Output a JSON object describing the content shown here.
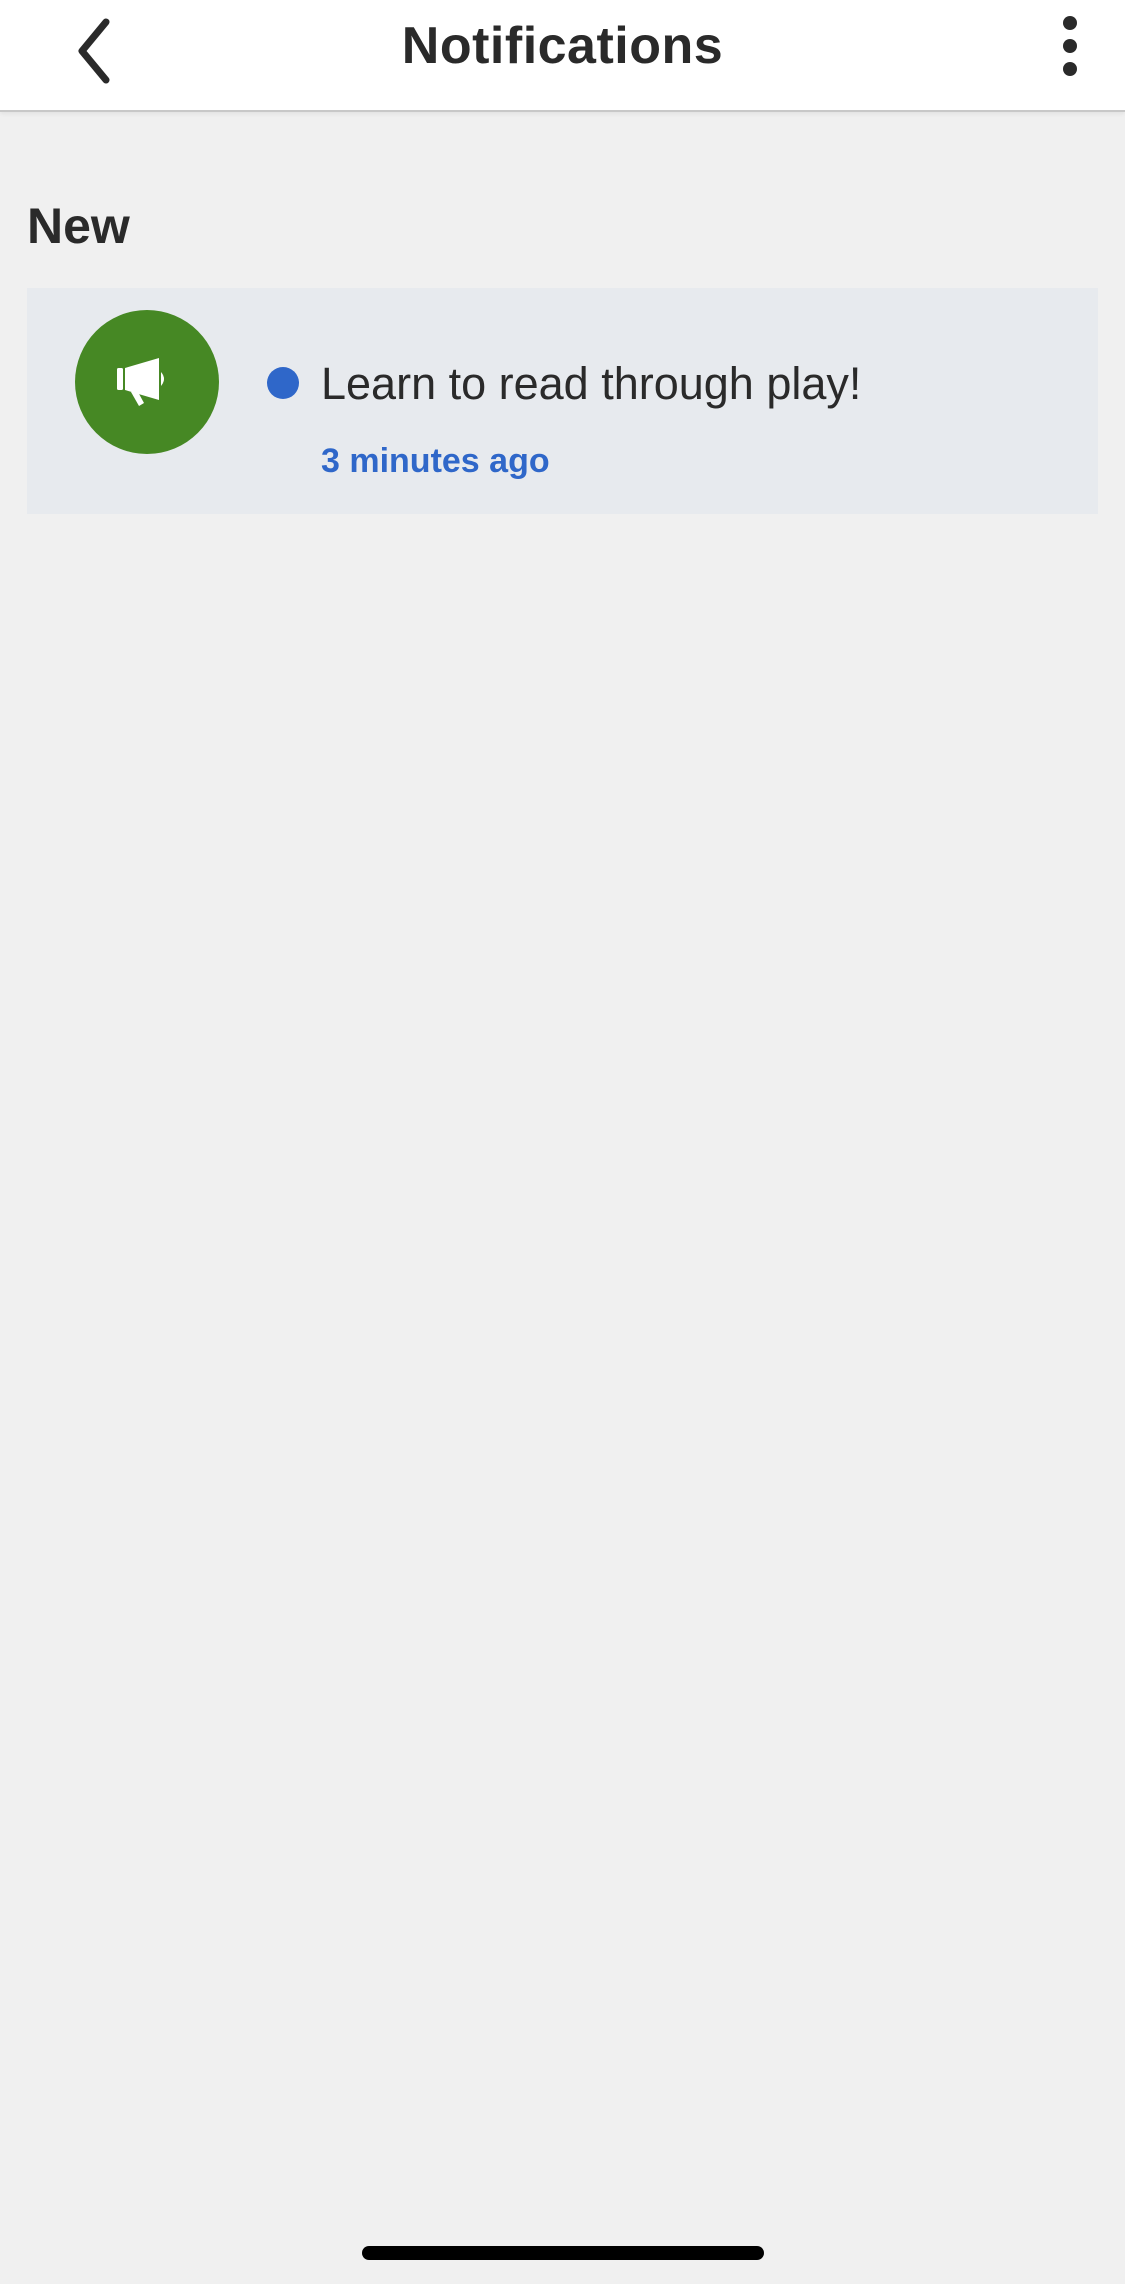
{
  "header": {
    "title": "Notifications",
    "back_icon": "chevron-left-icon",
    "more_icon": "more-vertical-icon"
  },
  "section": {
    "title": "New"
  },
  "notifications": [
    {
      "icon": "megaphone-icon",
      "icon_bg_color": "#468824",
      "unread": true,
      "title": "Learn to read through play!",
      "time": "3 minutes ago"
    }
  ],
  "colors": {
    "background": "#f0f0f0",
    "card_background": "#e7eaee",
    "accent": "#2f67c9",
    "text": "#2a2a2a"
  }
}
